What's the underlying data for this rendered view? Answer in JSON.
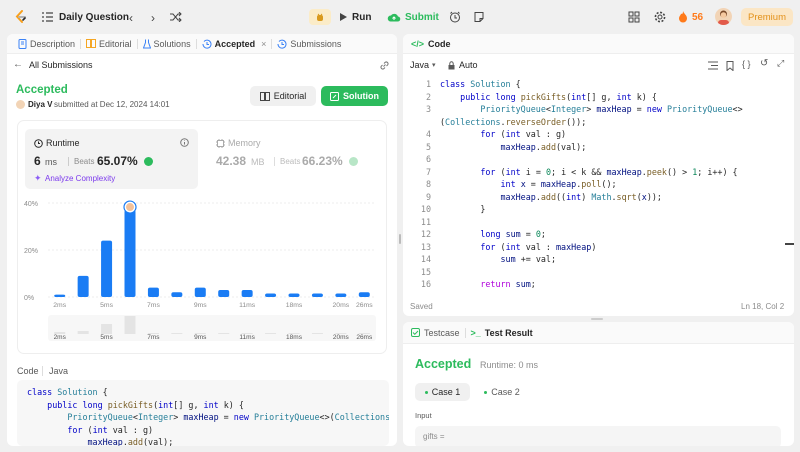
{
  "header": {
    "title": "Daily Question",
    "run": "Run",
    "submit": "Submit",
    "streak": "56",
    "premium": "Premium"
  },
  "left_tabs": [
    "Description",
    "Editorial",
    "Solutions",
    "Accepted",
    "Submissions"
  ],
  "all_submissions": "All Submissions",
  "result": {
    "status": "Accepted",
    "user": "Diya V",
    "submitted": "submitted at Dec 12, 2024 14:01",
    "editorial_btn": "Editorial",
    "solution_btn": "Solution"
  },
  "runtime": {
    "label": "Runtime",
    "value": "6",
    "unit": "ms",
    "beats_label": "Beats",
    "beats": "65.07%",
    "analyze": "Analyze Complexity"
  },
  "memory": {
    "label": "Memory",
    "value": "42.38",
    "unit": "MB",
    "beats_label": "Beats",
    "beats": "66.23%"
  },
  "chart_data": {
    "type": "bar",
    "ylabels": [
      "40%",
      "20%",
      "0%"
    ],
    "ylim": [
      0,
      40
    ],
    "values": [
      1,
      9,
      24,
      37,
      4,
      2,
      4,
      3,
      3,
      1.5,
      1.5,
      1.5,
      1.5,
      2
    ],
    "xlabels": [
      "2ms",
      "5ms",
      "7ms",
      "9ms",
      "11ms",
      "18ms",
      "20ms",
      "26ms"
    ],
    "mini_xlabels": [
      "2ms",
      "5ms",
      "7ms",
      "9ms",
      "11ms",
      "18ms",
      "20ms",
      "26ms"
    ],
    "mini_values": [
      1,
      1,
      1,
      1,
      1,
      1,
      1,
      1,
      1,
      1,
      1,
      1,
      1,
      1
    ],
    "highlight_index": 3,
    "colors": {
      "bar": "#1a7cf4",
      "mini": "#e4e4e4"
    }
  },
  "code_section": {
    "label": "Code",
    "lang": "Java"
  },
  "left_code": [
    "class Solution {",
    "    public long pickGifts(int[] g, int k) {",
    "        PriorityQueue<Integer> maxHeap = new PriorityQueue<>(Collections",
    "        for (int val : g)",
    "            maxHeap.add(val);"
  ],
  "editor": {
    "title": "Code",
    "lang": "Java",
    "mode": "Auto",
    "saved": "Saved",
    "pos": "Ln 18, Col 2"
  },
  "code_lines": [
    "class Solution {",
    "    public long pickGifts(int[] g, int k) {",
    "        PriorityQueue<Integer> maxHeap = new PriorityQueue<>",
    "(Collections.reverseOrder());",
    "        for (int val : g)",
    "            maxHeap.add(val);",
    "",
    "        for (int i = 0; i < k && maxHeap.peek() > 1; i++) {",
    "            int x = maxHeap.poll();",
    "            maxHeap.add((int) Math.sqrt(x));",
    "        }",
    "",
    "        long sum = 0;",
    "        for (int val : maxHeap)",
    "            sum += val;",
    "",
    "        return sum;"
  ],
  "line_numbers": [
    "1",
    "2",
    "3",
    "",
    "4",
    "5",
    "6",
    "7",
    "8",
    "9",
    "10",
    "11",
    "12",
    "13",
    "14",
    "15",
    "16"
  ],
  "bottom": {
    "tab1": "Testcase",
    "tab2": "Test Result",
    "status": "Accepted",
    "runtime": "Runtime: 0 ms",
    "case1": "Case 1",
    "case2": "Case 2",
    "input_label": "Input",
    "input_value": "gifts ="
  }
}
